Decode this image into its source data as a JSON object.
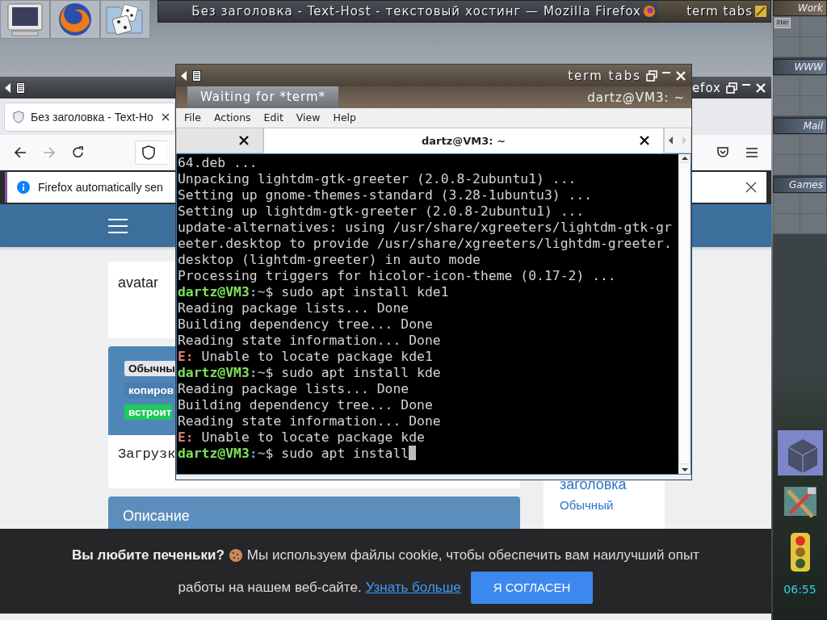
{
  "taskbar": [
    {
      "title": "Без заголовка - Text-Host - текстовый хостинг — Mozilla Firefox",
      "kind": "firefox"
    },
    {
      "title": "term tabs",
      "kind": "terminal"
    }
  ],
  "pager": {
    "desks": [
      {
        "name": "Work",
        "windows": [
          "Eter"
        ]
      },
      {
        "name": "WWW"
      },
      {
        "name": "Mail"
      },
      {
        "name": "Games"
      }
    ],
    "clock": "06:55"
  },
  "firefox": {
    "title": "efox",
    "tab": {
      "title": "Без заголовка - Text-Ho"
    },
    "nav": [
      {
        "kind": "back",
        "disabled": false
      },
      {
        "kind": "forward",
        "disabled": true
      },
      {
        "kind": "reload",
        "disabled": false
      }
    ],
    "notification": "Firefox automatically sen",
    "page": {
      "avatar": "avatar",
      "badges": [
        {
          "label": "Обычны",
          "color": "#e3e6ea"
        },
        {
          "label": "копиров",
          "color": "#4a7db0"
        },
        {
          "label": "встроит",
          "color": "#1ec95c"
        }
      ],
      "loading": "Загрузк",
      "section": "Описание",
      "sidebar": {
        "heading": "заголовка",
        "link": "Обычный"
      }
    },
    "cookie": {
      "question": "Вы любите печеньки?",
      "message": [
        "Мы используем файлы cookie, чтобы обеспечить вам наилучший опыт",
        "работы на нашем веб-сайте."
      ],
      "link": "Узнать больше",
      "button": "Я СОГЛАСЕН"
    }
  },
  "terminal": {
    "title": "term tabs",
    "waiting": "Waiting for *term*",
    "host": "dartz@VM3: ~",
    "menu": [
      "File",
      "Actions",
      "Edit",
      "View",
      "Help"
    ],
    "tabs": [
      {
        "selected": false
      },
      {
        "label": "dartz@VM3: ~",
        "selected": true
      }
    ],
    "lines": [
      {
        "kind": "plain",
        "text": "64.deb ..."
      },
      {
        "kind": "plain",
        "text": "Unpacking lightdm-gtk-greeter (2.0.8-2ubuntu1) ..."
      },
      {
        "kind": "plain",
        "text": "Setting up gnome-themes-standard (3.28-1ubuntu3) ..."
      },
      {
        "kind": "plain",
        "text": "Setting up lightdm-gtk-greeter (2.0.8-2ubuntu1) ..."
      },
      {
        "kind": "plain",
        "text": "update-alternatives: using /usr/share/xgreeters/lightdm-gtk-gr"
      },
      {
        "kind": "plain",
        "text": "eeter.desktop to provide /usr/share/xgreeters/lightdm-greeter."
      },
      {
        "kind": "plain",
        "text": "desktop (lightdm-greeter) in auto mode"
      },
      {
        "kind": "plain",
        "text": "Processing triggers for hicolor-icon-theme (0.17-2) ..."
      },
      {
        "kind": "prompt",
        "user": "dartz@VM3",
        "path": ":~",
        "symbol": "$",
        "command": "sudo apt install kde1",
        "cursor": false
      },
      {
        "kind": "plain",
        "text": "Reading package lists... Done"
      },
      {
        "kind": "plain",
        "text": "Building dependency tree... Done"
      },
      {
        "kind": "plain",
        "text": "Reading state information... Done"
      },
      {
        "kind": "error",
        "tag": "E:",
        "text": "Unable to locate package kde1"
      },
      {
        "kind": "prompt",
        "user": "dartz@VM3",
        "path": ":~",
        "symbol": "$",
        "command": "sudo apt install kde",
        "cursor": false
      },
      {
        "kind": "plain",
        "text": "Reading package lists... Done"
      },
      {
        "kind": "plain",
        "text": "Building dependency tree... Done"
      },
      {
        "kind": "plain",
        "text": "Reading state information... Done"
      },
      {
        "kind": "error",
        "tag": "E:",
        "text": "Unable to locate package kde"
      },
      {
        "kind": "prompt",
        "user": "dartz@VM3",
        "path": ":~",
        "symbol": "$",
        "command": "sudo apt install",
        "cursor": true
      }
    ]
  }
}
